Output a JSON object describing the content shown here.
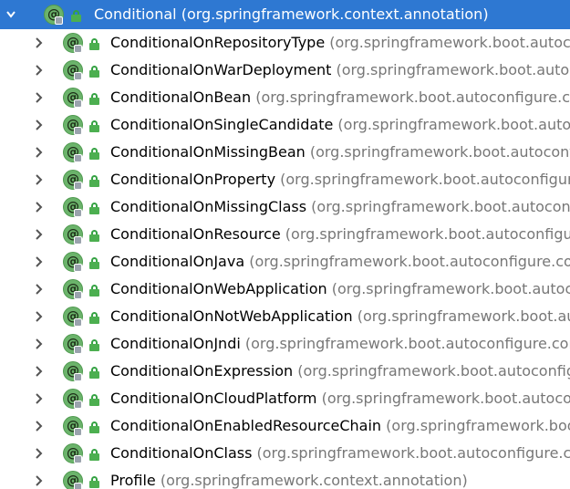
{
  "root": {
    "name": "Conditional",
    "package": " (org.springframework.context.annotation)",
    "expanded": true,
    "icon_glyph": "@",
    "icon": "annotation-icon"
  },
  "children": [
    {
      "name": "ConditionalOnRepositoryType",
      "package": " (org.springframework.boot.autoconfigure.data)"
    },
    {
      "name": "ConditionalOnWarDeployment",
      "package": " (org.springframework.boot.autoconfigure.condition)"
    },
    {
      "name": "ConditionalOnBean",
      "package": " (org.springframework.boot.autoconfigure.condition)"
    },
    {
      "name": "ConditionalOnSingleCandidate",
      "package": " (org.springframework.boot.autoconfigure.condition)"
    },
    {
      "name": "ConditionalOnMissingBean",
      "package": " (org.springframework.boot.autoconfigure.condition)"
    },
    {
      "name": "ConditionalOnProperty",
      "package": " (org.springframework.boot.autoconfigure.condition)"
    },
    {
      "name": "ConditionalOnMissingClass",
      "package": " (org.springframework.boot.autoconfigure.condition)"
    },
    {
      "name": "ConditionalOnResource",
      "package": " (org.springframework.boot.autoconfigure.condition)"
    },
    {
      "name": "ConditionalOnJava",
      "package": " (org.springframework.boot.autoconfigure.condition)"
    },
    {
      "name": "ConditionalOnWebApplication",
      "package": " (org.springframework.boot.autoconfigure.condition)"
    },
    {
      "name": "ConditionalOnNotWebApplication",
      "package": " (org.springframework.boot.autoconfigure.condition)"
    },
    {
      "name": "ConditionalOnJndi",
      "package": " (org.springframework.boot.autoconfigure.condition)"
    },
    {
      "name": "ConditionalOnExpression",
      "package": " (org.springframework.boot.autoconfigure.condition)"
    },
    {
      "name": "ConditionalOnCloudPlatform",
      "package": " (org.springframework.boot.autoconfigure.condition)"
    },
    {
      "name": "ConditionalOnEnabledResourceChain",
      "package": " (org.springframework.boot.autoconfigure.web)"
    },
    {
      "name": "ConditionalOnClass",
      "package": " (org.springframework.boot.autoconfigure.condition)"
    },
    {
      "name": "Profile",
      "package": " (org.springframework.context.annotation)"
    }
  ],
  "colors": {
    "selection": "#2e78d2",
    "annotation_icon": "#6bb36b",
    "lock_icon": "#4caf50",
    "package_text": "#777777"
  }
}
